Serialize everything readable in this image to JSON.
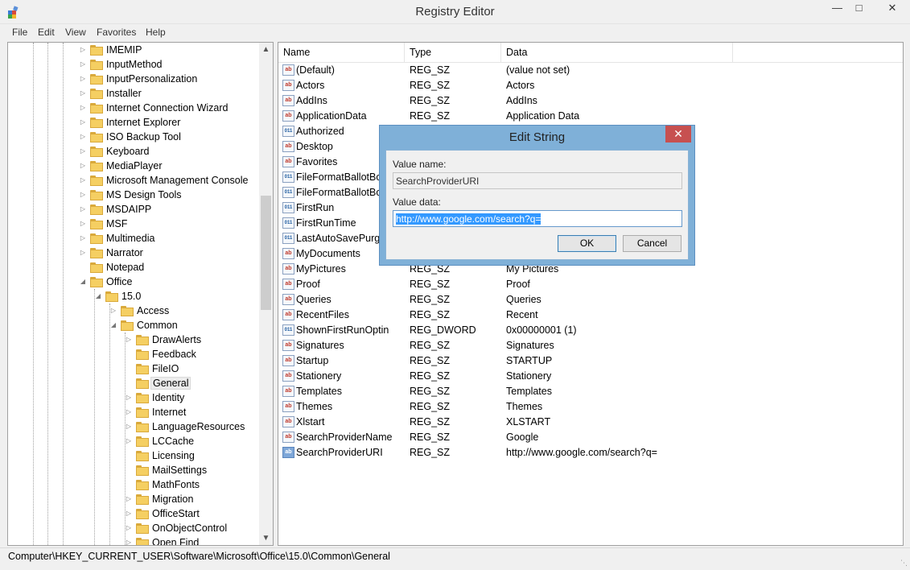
{
  "window": {
    "title": "Registry Editor",
    "min_icon": "minimize-icon",
    "max_icon": "maximize-icon",
    "close_icon": "close-icon"
  },
  "menu": [
    "File",
    "Edit",
    "View",
    "Favorites",
    "Help"
  ],
  "tree": [
    {
      "label": "IMEMIP"
    },
    {
      "label": "InputMethod"
    },
    {
      "label": "InputPersonalization"
    },
    {
      "label": "Installer"
    },
    {
      "label": "Internet Connection Wizard"
    },
    {
      "label": "Internet Explorer"
    },
    {
      "label": "ISO Backup Tool"
    },
    {
      "label": "Keyboard"
    },
    {
      "label": "MediaPlayer"
    },
    {
      "label": "Microsoft Management Console"
    },
    {
      "label": "MS Design Tools"
    },
    {
      "label": "MSDAIPP"
    },
    {
      "label": "MSF"
    },
    {
      "label": "Multimedia"
    },
    {
      "label": "Narrator"
    },
    {
      "label": "Notepad"
    },
    {
      "label": "Office"
    },
    {
      "label": "15.0"
    },
    {
      "label": "Access"
    },
    {
      "label": "Common"
    },
    {
      "label": "DrawAlerts"
    },
    {
      "label": "Feedback"
    },
    {
      "label": "FileIO"
    },
    {
      "label": "General"
    },
    {
      "label": "Identity"
    },
    {
      "label": "Internet"
    },
    {
      "label": "LanguageResources"
    },
    {
      "label": "LCCache"
    },
    {
      "label": "Licensing"
    },
    {
      "label": "MailSettings"
    },
    {
      "label": "MathFonts"
    },
    {
      "label": "Migration"
    },
    {
      "label": "OfficeStart"
    },
    {
      "label": "OnObjectControl"
    },
    {
      "label": "Open Find"
    }
  ],
  "list": {
    "columns": [
      "Name",
      "Type",
      "Data"
    ],
    "rows": [
      {
        "name": "(Default)",
        "type": "REG_SZ",
        "data": "(value not set)",
        "icon": "sz"
      },
      {
        "name": "Actors",
        "type": "REG_SZ",
        "data": "Actors",
        "icon": "sz"
      },
      {
        "name": "AddIns",
        "type": "REG_SZ",
        "data": "AddIns",
        "icon": "sz"
      },
      {
        "name": "ApplicationData",
        "type": "REG_SZ",
        "data": "Application Data",
        "icon": "sz"
      },
      {
        "name": "Authorized",
        "type": "",
        "data": "",
        "icon": "bin"
      },
      {
        "name": "Desktop",
        "type": "",
        "data": "",
        "icon": "sz"
      },
      {
        "name": "Favorites",
        "type": "",
        "data": "",
        "icon": "sz"
      },
      {
        "name": "FileFormatBallotBox",
        "type": "",
        "data": "",
        "icon": "bin"
      },
      {
        "name": "FileFormatBallotBox",
        "type": "",
        "data": "",
        "icon": "bin"
      },
      {
        "name": "FirstRun",
        "type": "",
        "data": "",
        "icon": "bin"
      },
      {
        "name": "FirstRunTime",
        "type": "",
        "data": "",
        "icon": "bin"
      },
      {
        "name": "LastAutoSavePurge",
        "type": "",
        "data": "",
        "icon": "bin"
      },
      {
        "name": "MyDocuments",
        "type": "",
        "data": "",
        "icon": "sz"
      },
      {
        "name": "MyPictures",
        "type": "REG_SZ",
        "data": "My Pictures",
        "icon": "sz"
      },
      {
        "name": "Proof",
        "type": "REG_SZ",
        "data": "Proof",
        "icon": "sz"
      },
      {
        "name": "Queries",
        "type": "REG_SZ",
        "data": "Queries",
        "icon": "sz"
      },
      {
        "name": "RecentFiles",
        "type": "REG_SZ",
        "data": "Recent",
        "icon": "sz"
      },
      {
        "name": "ShownFirstRunOptin",
        "type": "REG_DWORD",
        "data": "0x00000001 (1)",
        "icon": "bin"
      },
      {
        "name": "Signatures",
        "type": "REG_SZ",
        "data": "Signatures",
        "icon": "sz"
      },
      {
        "name": "Startup",
        "type": "REG_SZ",
        "data": "STARTUP",
        "icon": "sz"
      },
      {
        "name": "Stationery",
        "type": "REG_SZ",
        "data": "Stationery",
        "icon": "sz"
      },
      {
        "name": "Templates",
        "type": "REG_SZ",
        "data": "Templates",
        "icon": "sz"
      },
      {
        "name": "Themes",
        "type": "REG_SZ",
        "data": "Themes",
        "icon": "sz"
      },
      {
        "name": "Xlstart",
        "type": "REG_SZ",
        "data": "XLSTART",
        "icon": "sz"
      },
      {
        "name": "SearchProviderName",
        "type": "REG_SZ",
        "data": "Google",
        "icon": "sz"
      },
      {
        "name": "SearchProviderURI",
        "type": "REG_SZ",
        "data": "http://www.google.com/search?q=",
        "icon": "sz-hl"
      }
    ]
  },
  "status": {
    "path": "Computer\\HKEY_CURRENT_USER\\Software\\Microsoft\\Office\\15.0\\Common\\General"
  },
  "dialog": {
    "title": "Edit String",
    "close_icon": "close-icon",
    "value_name_label": "Value name:",
    "value_name": "SearchProviderURI",
    "value_data_label": "Value data:",
    "value_data": "http://www.google.com/search?q=",
    "ok_label": "OK",
    "cancel_label": "Cancel"
  }
}
